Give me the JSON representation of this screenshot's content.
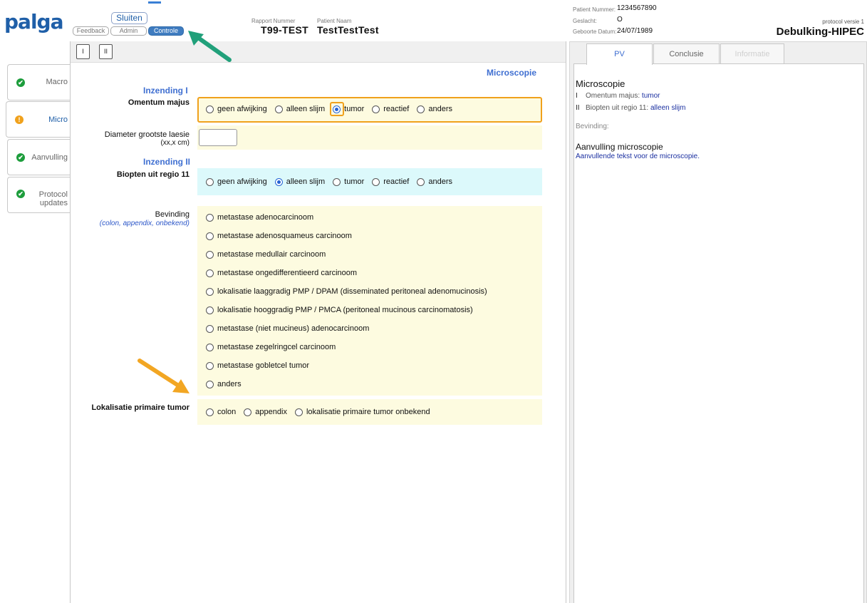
{
  "header": {
    "logo_text": "palga",
    "buttons": {
      "sluiten": "Sluiten",
      "feedback": "Feedback",
      "admin": "Admin",
      "controle": "Controle"
    },
    "rapport_nummer_label": "Rapport Nummer",
    "rapport_nummer": "T99-TEST",
    "patient_naam_label": "Patient Naam",
    "patient_naam": "TestTestTest",
    "patient_nummer_label": "Patient Nummer:",
    "patient_nummer": "1234567890",
    "geslacht_label": "Geslacht:",
    "geslacht": "O",
    "geboorte_label": "Geboorte Datum:",
    "geboorte": "24/07/1989",
    "protocol_versie": "protocol versie 1",
    "protocol_naam": "Debulking-HIPEC"
  },
  "nav": {
    "items": [
      {
        "label": "Macro",
        "status": "ok"
      },
      {
        "label": "Micro",
        "status": "warn"
      },
      {
        "label": "Aanvulling",
        "status": "ok"
      },
      {
        "label": "Protocol updates",
        "status": "ok"
      }
    ],
    "status_glyph_ok": "✔",
    "status_glyph_warn": "!"
  },
  "toolbar": {
    "btn_1": "I",
    "btn_2": "II"
  },
  "form": {
    "heading": "Microscopie",
    "inzending_1": "Inzending I",
    "omentum_label": "Omentum majus",
    "omentum_options": [
      "geen afwijking",
      "alleen slijm",
      "tumor",
      "reactief",
      "anders"
    ],
    "omentum_selected": "tumor",
    "diameter_label": "Diameter grootste laesie",
    "diameter_unit": "(xx,x cm)",
    "diameter_value": "",
    "inzending_2": "Inzending II",
    "biopten_label": "Biopten uit regio 11",
    "biopten_options": [
      "geen afwijking",
      "alleen slijm",
      "tumor",
      "reactief",
      "anders"
    ],
    "biopten_selected": "alleen slijm",
    "bevinding_label": "Bevinding",
    "bevinding_sub": "(colon, appendix, onbekend)",
    "bevinding_options": [
      "metastase adenocarcinoom",
      "metastase adenosquameus carcinoom",
      "metastase medullair carcinoom",
      "metastase ongedifferentieerd carcinoom",
      "lokalisatie laaggradig PMP / DPAM (disseminated peritoneal adenomucinosis)",
      "lokalisatie hooggradig PMP / PMCA (peritoneal mucinous carcinomatosis)",
      "metastase (niet mucineus) adenocarcinoom",
      "metastase zegelringcel carcinoom",
      "metastase gobletcel tumor",
      "anders"
    ],
    "lokalisatie_label": "Lokalisatie primaire tumor",
    "lokalisatie_options": [
      "colon",
      "appendix",
      "lokalisatie primaire tumor onbekend"
    ]
  },
  "right": {
    "tabs": [
      "PV",
      "Conclusie",
      "Informatie"
    ],
    "summary_title": "Microscopie",
    "summary_lines": [
      {
        "roman": "I",
        "label": "Omentum majus:",
        "value": "tumor"
      },
      {
        "roman": "II",
        "label": "Biopten uit regio 11:",
        "value": "alleen slijm"
      }
    ],
    "bevinding_label": "Bevinding:",
    "aanvulling_title": "Aanvulling microscopie",
    "aanvulling_text": "Aanvullende tekst voor de microscopie."
  },
  "colors": {
    "accent_blue": "#3f6fd1",
    "form_yellow": "#fdfbe0",
    "form_cyan": "#dcf9fb",
    "highlight_orange": "#f0a11c",
    "annotation_green": "#21a07a",
    "annotation_orange": "#f2a623"
  }
}
